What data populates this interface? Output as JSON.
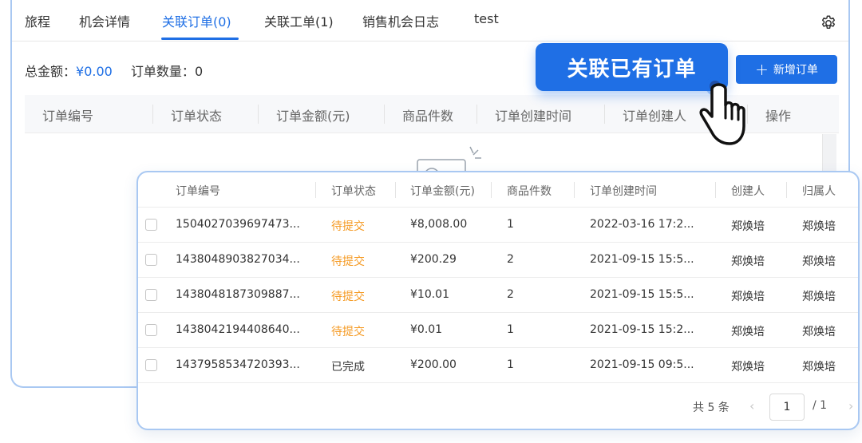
{
  "tabs": [
    {
      "label": "旅程"
    },
    {
      "label": "机会详情"
    },
    {
      "label": "关联订单(0)"
    },
    {
      "label": "关联工单(1)"
    },
    {
      "label": "销售机会日志"
    },
    {
      "label": "test"
    }
  ],
  "summary": {
    "amount_label": "总金额：",
    "amount_value": "¥0.00",
    "count_label": "订单数量：",
    "count_value": "0"
  },
  "new_order_button": {
    "icon": "+",
    "label": "新增订单"
  },
  "callout_button": {
    "label": "关联已有订单"
  },
  "back_table": {
    "columns": [
      "订单编号",
      "订单状态",
      "订单金额(元)",
      "商品件数",
      "订单创建时间",
      "订单创建人",
      "操作"
    ]
  },
  "order_picker": {
    "columns": [
      "订单编号",
      "订单状态",
      "订单金额(元)",
      "商品件数",
      "订单创建时间",
      "创建人",
      "归属人"
    ],
    "rows": [
      {
        "id": "1504027039697473...",
        "status": "待提交",
        "amount": "¥8,008.00",
        "qty": "1",
        "created": "2022-03-16 17:2...",
        "creator": "郑焕培",
        "owner": "郑焕培"
      },
      {
        "id": "1438048903827034...",
        "status": "待提交",
        "amount": "¥200.29",
        "qty": "2",
        "created": "2021-09-15 15:5...",
        "creator": "郑焕培",
        "owner": "郑焕培"
      },
      {
        "id": "1438048187309887...",
        "status": "待提交",
        "amount": "¥10.01",
        "qty": "2",
        "created": "2021-09-15 15:5...",
        "creator": "郑焕培",
        "owner": "郑焕培"
      },
      {
        "id": "1438042194408640...",
        "status": "待提交",
        "amount": "¥0.01",
        "qty": "1",
        "created": "2021-09-15 15:2...",
        "creator": "郑焕培",
        "owner": "郑焕培"
      },
      {
        "id": "1437958534720393...",
        "status": "已完成",
        "amount": "¥200.00",
        "qty": "1",
        "created": "2021-09-15 09:5...",
        "creator": "郑焕培",
        "owner": "郑焕培"
      }
    ],
    "pagination": {
      "total": "共 5 条",
      "current": "1",
      "of": "/ 1"
    }
  },
  "colors": {
    "primary": "#1f6fe5",
    "pending": "#f59a23",
    "card_border": "#a9c8f2"
  },
  "icons": {
    "settings": "gear-icon",
    "cursor": "hand-pointer-icon"
  }
}
